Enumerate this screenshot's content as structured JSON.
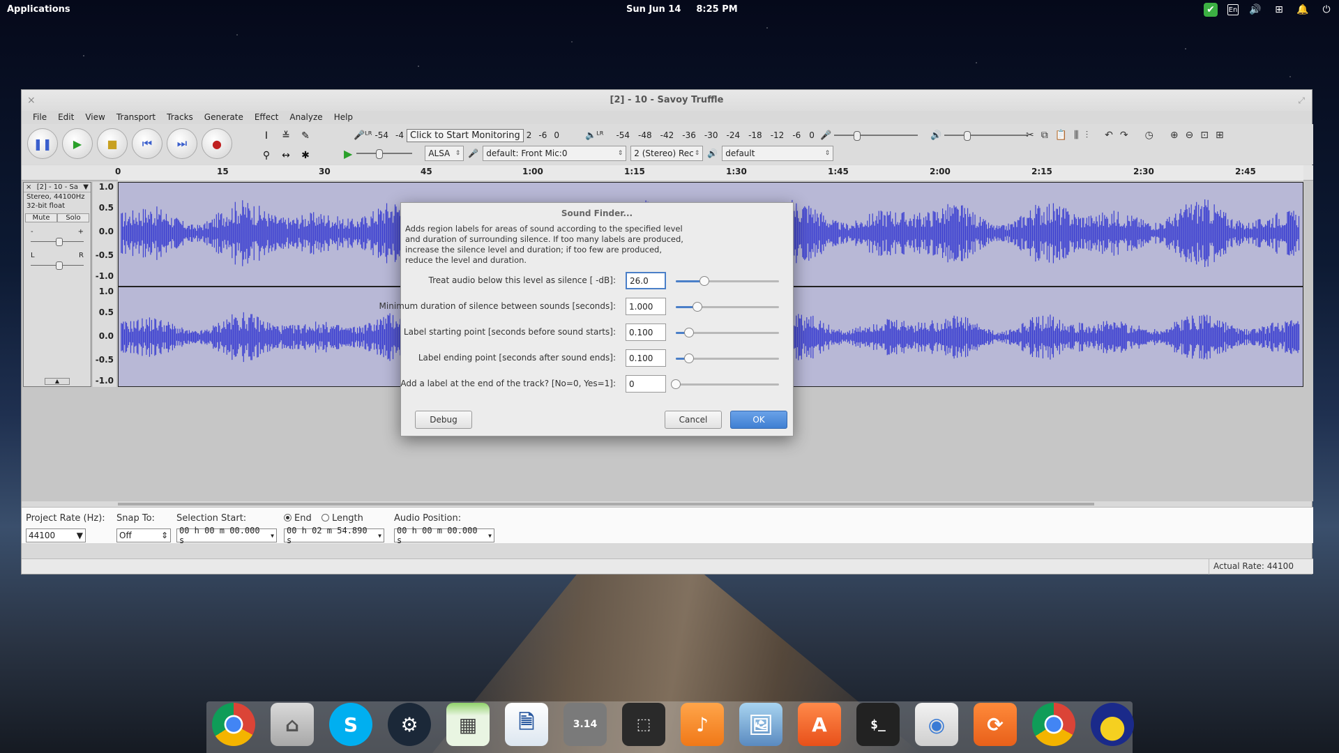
{
  "top_panel": {
    "applications_label": "Applications",
    "date": "Sun Jun 14",
    "time": "8:25 PM",
    "tray_icons": [
      "check-icon",
      "keyboard-layout-icon",
      "volume-icon",
      "network-icon",
      "notifications-icon",
      "power-icon"
    ],
    "keyboard_layout": "En"
  },
  "window": {
    "title": "[2] - 10 - Savoy Truffle",
    "menu": [
      "File",
      "Edit",
      "View",
      "Transport",
      "Tracks",
      "Generate",
      "Effect",
      "Analyze",
      "Help"
    ]
  },
  "toolbar": {
    "record_meter_scale": [
      "-54",
      "-4"
    ],
    "monitor_button_label": "Click to Start Monitoring",
    "record_meter_tail": [
      "2",
      "-6",
      "0"
    ],
    "play_meter_scale": [
      "-54",
      "-48",
      "-42",
      "-36",
      "-30",
      "-24",
      "-18",
      "-12",
      "-6",
      "0"
    ],
    "host": "ALSA",
    "input_device": "default: Front Mic:0",
    "channels": "2 (Stereo) Rec",
    "output_device": "default"
  },
  "ruler": {
    "ticks": [
      "0",
      "15",
      "30",
      "45",
      "1:00",
      "1:15",
      "1:30",
      "1:45",
      "2:00",
      "2:15",
      "2:30",
      "2:45"
    ]
  },
  "track": {
    "name": "[2] - 10 - Sa",
    "format": "Stereo, 44100Hz",
    "bit_depth": "32-bit float",
    "mute_label": "Mute",
    "solo_label": "Solo",
    "gain_min": "-",
    "gain_max": "+",
    "pan_left": "L",
    "pan_right": "R",
    "amplitude_scale": [
      "1.0",
      "0.5",
      "0.0",
      "-0.5",
      "-1.0"
    ],
    "wave_color": "#3b3fd1"
  },
  "dialog": {
    "title": "Sound Finder...",
    "description": "Adds region labels for areas of sound according to the specified level and duration of surrounding silence. If too many labels are produced, increase the silence level and duration; if too few are produced, reduce the level and duration.",
    "fields": [
      {
        "label": "Treat audio below this level as silence [ -dB]:",
        "value": "26.0",
        "slider": 0.28
      },
      {
        "label": "Minimum duration of silence between sounds [seconds]:",
        "value": "1.000",
        "slider": 0.21
      },
      {
        "label": "Label starting point [seconds before sound starts]:",
        "value": "0.100",
        "slider": 0.13
      },
      {
        "label": "Label ending point [seconds after sound ends]:",
        "value": "0.100",
        "slider": 0.13
      },
      {
        "label": "Add a label at the end of the track? [No=0, Yes=1]:",
        "value": "0",
        "slider": 0.0
      }
    ],
    "debug_label": "Debug",
    "cancel_label": "Cancel",
    "ok_label": "OK"
  },
  "selection_bar": {
    "project_rate_label": "Project Rate (Hz):",
    "project_rate": "44100",
    "snap_to_label": "Snap To:",
    "snap_to": "Off",
    "selection_start_label": "Selection Start:",
    "selection_start": "00 h 00 m 00.000 s",
    "end_label": "End",
    "length_label": "Length",
    "selection_end": "00 h 02 m 54.890 s",
    "audio_position_label": "Audio Position:",
    "audio_position": "00 h 00 m 00.000 s",
    "actual_rate": "Actual Rate: 44100"
  },
  "dock": {
    "apps": [
      "chrome",
      "files",
      "skype",
      "steam",
      "spreadsheet",
      "document-viewer",
      "calculator",
      "screenshot",
      "music",
      "photos",
      "app-store",
      "terminal",
      "switchboard",
      "sync",
      "chrome",
      "audacity"
    ],
    "calculator_display": "3.14"
  }
}
